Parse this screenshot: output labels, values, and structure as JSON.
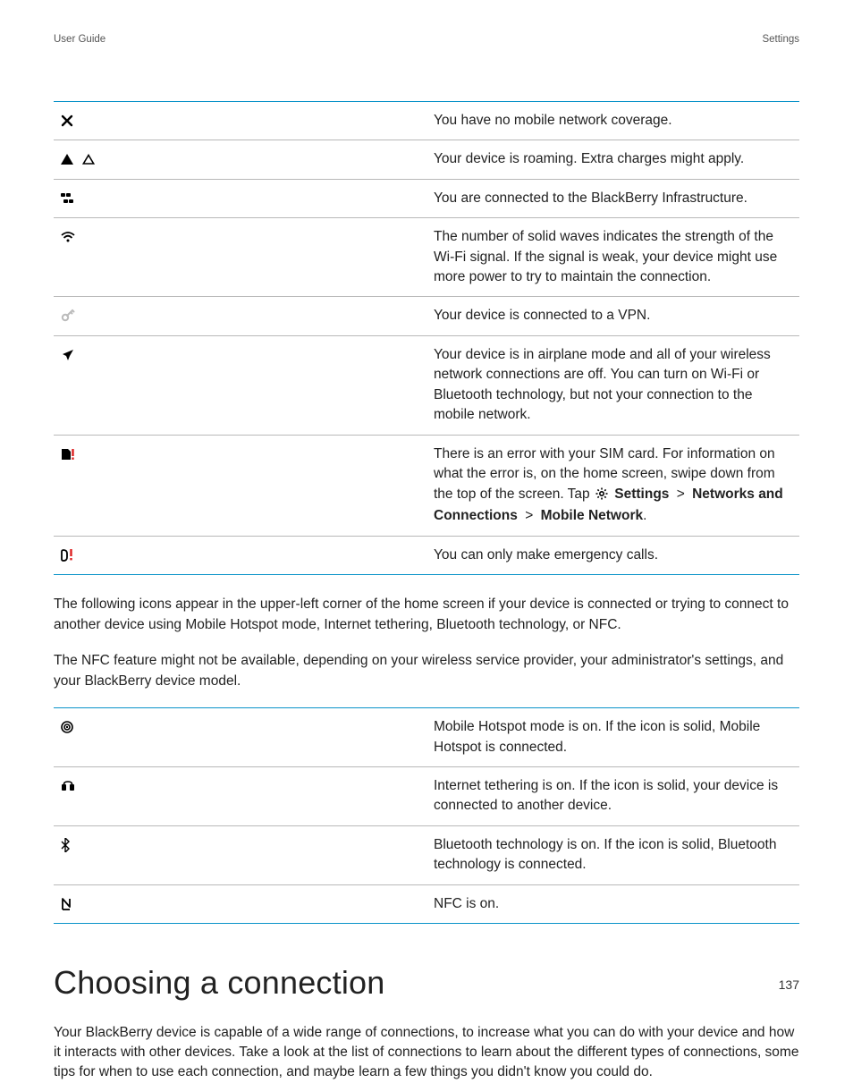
{
  "header": {
    "left": "User Guide",
    "right": "Settings"
  },
  "table1": {
    "rows": [
      {
        "icon": "x-icon",
        "desc": "You have no mobile network coverage."
      },
      {
        "icon": "roaming-icon",
        "desc": "Your device is roaming. Extra charges might apply."
      },
      {
        "icon": "bb-infra-icon",
        "desc": "You are connected to the BlackBerry Infrastructure."
      },
      {
        "icon": "wifi-icon",
        "desc": "The number of solid waves indicates the strength of the Wi-Fi signal. If the signal is weak, your device might use more power to try to maintain the connection."
      },
      {
        "icon": "vpn-key-icon",
        "desc": "Your device is connected to a VPN."
      },
      {
        "icon": "airplane-icon",
        "desc": "Your device is in airplane mode and all of your wireless network connections are off. You can turn on Wi-Fi or Bluetooth technology, but not your connection to the mobile network."
      },
      {
        "icon": "sim-error-icon",
        "desc_parts": {
          "p1": "There is an error with your SIM card. For information on what the error is, on the home screen, swipe down from the top of the screen. Tap ",
          "settings_label": "Settings",
          "gt": ">",
          "networks_label": "Networks and Connections",
          "mobile_label": "Mobile Network",
          "period": "."
        }
      },
      {
        "icon": "emergency-icon",
        "desc": "You can only make emergency calls."
      }
    ]
  },
  "para1": "The following icons appear in the upper-left corner of the home screen if your device is connected or trying to connect to another device using Mobile Hotspot mode, Internet tethering, Bluetooth technology, or NFC.",
  "para2": "The NFC feature might not be available, depending on your wireless service provider, your administrator's settings, and your BlackBerry device model.",
  "table2": {
    "rows": [
      {
        "icon": "hotspot-icon",
        "desc": "Mobile Hotspot mode is on. If the icon is solid, Mobile Hotspot is connected."
      },
      {
        "icon": "tether-icon",
        "desc": "Internet tethering is on. If the icon is solid, your device is connected to another device."
      },
      {
        "icon": "bluetooth-icon",
        "desc": "Bluetooth technology is on. If the icon is solid, Bluetooth technology is connected."
      },
      {
        "icon": "nfc-icon",
        "desc": "NFC is on."
      }
    ]
  },
  "section_title": "Choosing a connection",
  "section_para": "Your BlackBerry device is capable of a wide range of connections, to increase what you can do with your device and how it interacts with other devices. Take a look at the list of connections to learn about the different types of connections, some tips for when to use each connection, and maybe learn a few things you didn't know you could do.",
  "page_number": "137"
}
